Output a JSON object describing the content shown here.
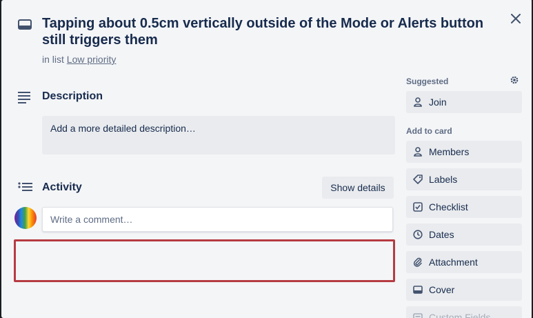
{
  "card": {
    "title": "Tapping about 0.5cm vertically outside of the Mode or Alerts button still triggers them",
    "in_list_prefix": "in list",
    "list_name": "Low priority"
  },
  "description": {
    "heading": "Description",
    "placeholder": "Add a more detailed description…"
  },
  "activity": {
    "heading": "Activity",
    "show_details_label": "Show details",
    "comment_placeholder": "Write a comment…"
  },
  "sidebar": {
    "suggested_label": "Suggested",
    "join_label": "Join",
    "add_to_card_label": "Add to card",
    "items": [
      {
        "label": "Members",
        "icon": "person-icon"
      },
      {
        "label": "Labels",
        "icon": "tag-icon"
      },
      {
        "label": "Checklist",
        "icon": "checklist-icon"
      },
      {
        "label": "Dates",
        "icon": "clock-icon"
      },
      {
        "label": "Attachment",
        "icon": "paperclip-icon"
      },
      {
        "label": "Cover",
        "icon": "cover-icon"
      },
      {
        "label": "Custom Fields",
        "icon": "custom-fields-icon"
      }
    ]
  },
  "colors": {
    "highlight": "#b63b42",
    "modal_bg": "#f4f5f7",
    "button_bg": "#e9ebee"
  }
}
